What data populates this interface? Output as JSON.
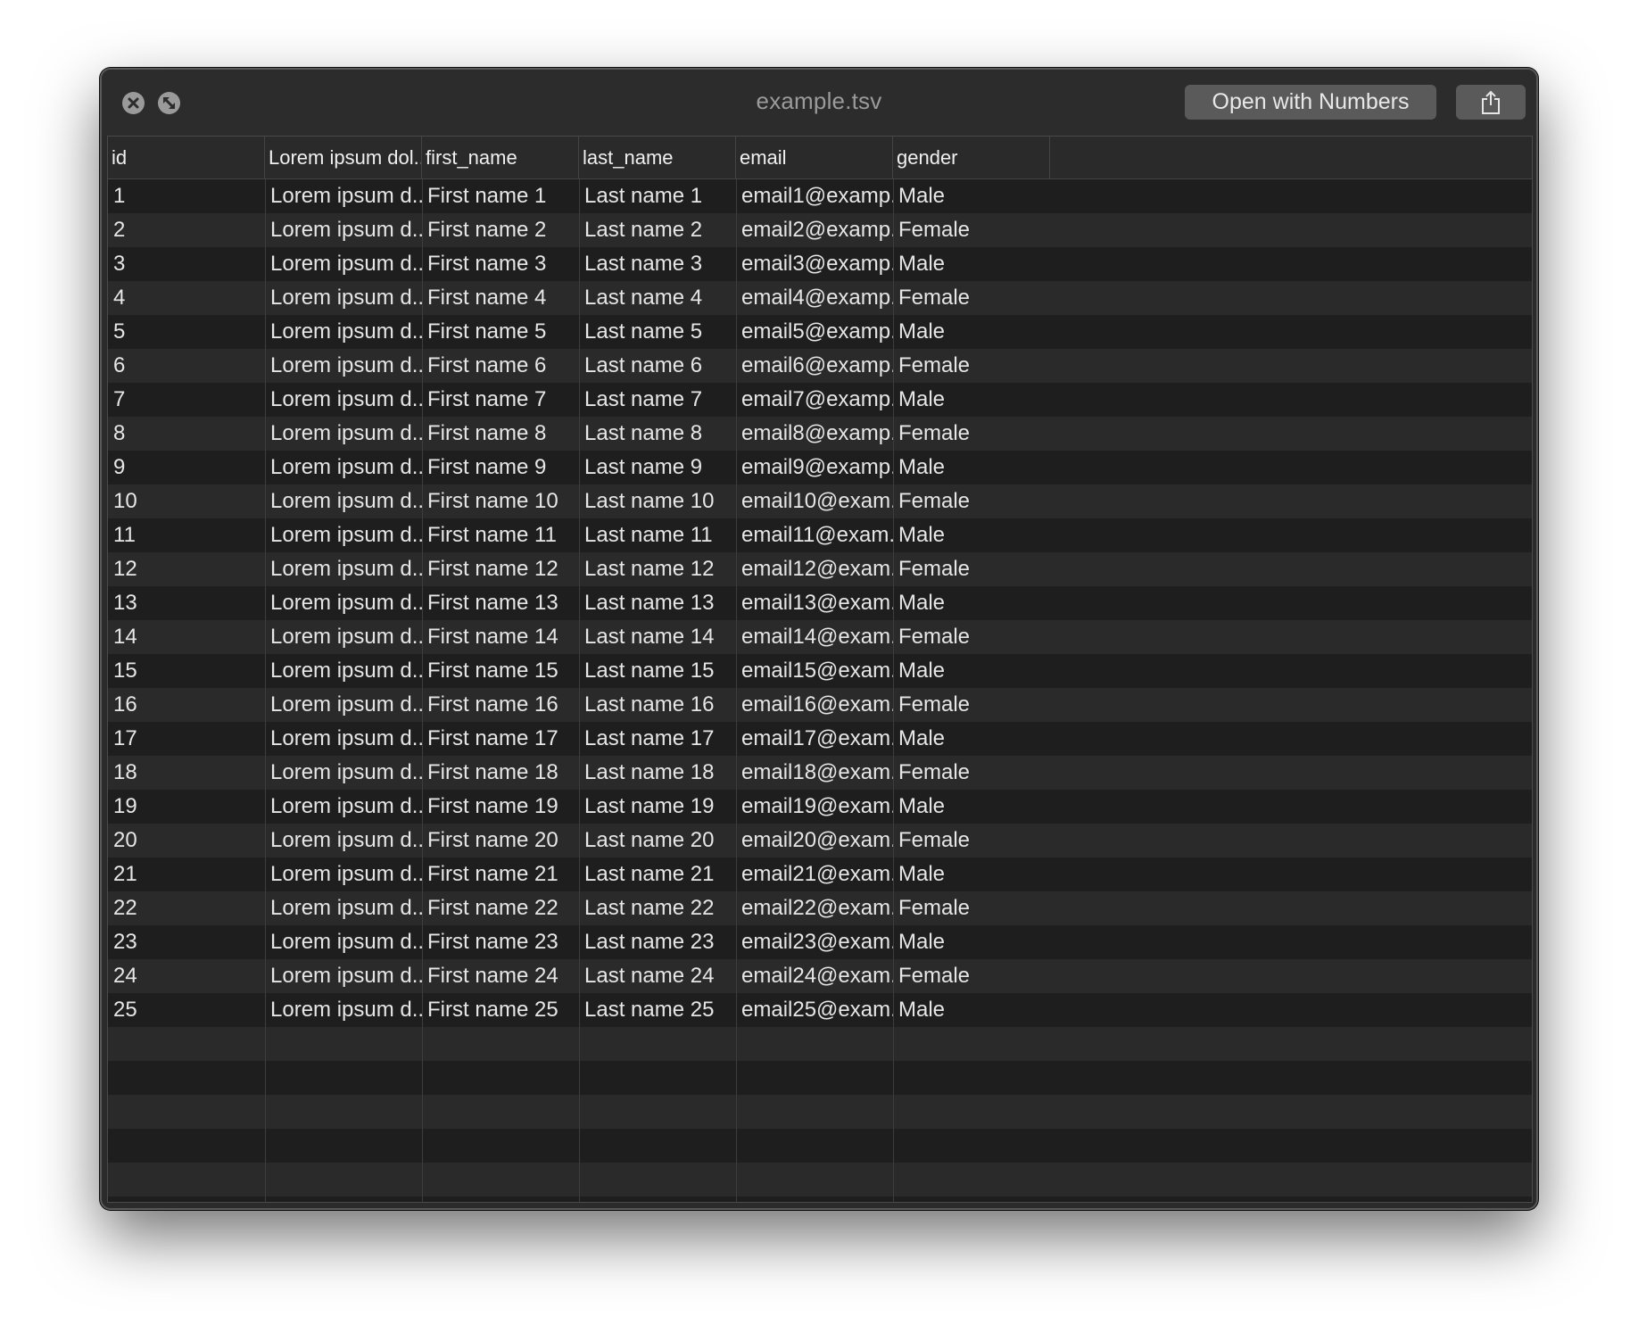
{
  "window": {
    "title": "example.tsv",
    "open_button_label": "Open with Numbers",
    "icons": {
      "close": "close-icon",
      "fullscreen": "fullscreen-icon",
      "share": "share-icon"
    }
  },
  "table": {
    "columns": [
      "id",
      "Lorem ipsum dol...",
      "first_name",
      "last_name",
      "email",
      "gender"
    ],
    "rows": [
      [
        "1",
        "Lorem ipsum d...",
        "First name 1",
        "Last name 1",
        "email1@examp...",
        "Male"
      ],
      [
        "2",
        "Lorem ipsum d...",
        "First name 2",
        "Last name 2",
        "email2@examp...",
        "Female"
      ],
      [
        "3",
        "Lorem ipsum d...",
        "First name 3",
        "Last name 3",
        "email3@examp...",
        "Male"
      ],
      [
        "4",
        "Lorem ipsum d...",
        "First name 4",
        "Last name 4",
        "email4@examp...",
        "Female"
      ],
      [
        "5",
        "Lorem ipsum d...",
        "First name 5",
        "Last name 5",
        "email5@examp...",
        "Male"
      ],
      [
        "6",
        "Lorem ipsum d...",
        "First name 6",
        "Last name 6",
        "email6@examp...",
        "Female"
      ],
      [
        "7",
        "Lorem ipsum d...",
        "First name 7",
        "Last name 7",
        "email7@examp...",
        "Male"
      ],
      [
        "8",
        "Lorem ipsum d...",
        "First name 8",
        "Last name 8",
        "email8@examp...",
        "Female"
      ],
      [
        "9",
        "Lorem ipsum d...",
        "First name 9",
        "Last name 9",
        "email9@examp...",
        "Male"
      ],
      [
        "10",
        "Lorem ipsum d...",
        "First name 10",
        "Last name 10",
        "email10@exam...",
        "Female"
      ],
      [
        "11",
        "Lorem ipsum d...",
        "First name 11",
        "Last name 11",
        "email11@exam...",
        "Male"
      ],
      [
        "12",
        "Lorem ipsum d...",
        "First name 12",
        "Last name 12",
        "email12@exam...",
        "Female"
      ],
      [
        "13",
        "Lorem ipsum d...",
        "First name 13",
        "Last name 13",
        "email13@exam...",
        "Male"
      ],
      [
        "14",
        "Lorem ipsum d...",
        "First name 14",
        "Last name 14",
        "email14@exam...",
        "Female"
      ],
      [
        "15",
        "Lorem ipsum d...",
        "First name 15",
        "Last name 15",
        "email15@exam...",
        "Male"
      ],
      [
        "16",
        "Lorem ipsum d...",
        "First name 16",
        "Last name 16",
        "email16@exam...",
        "Female"
      ],
      [
        "17",
        "Lorem ipsum d...",
        "First name 17",
        "Last name 17",
        "email17@exam...",
        "Male"
      ],
      [
        "18",
        "Lorem ipsum d...",
        "First name 18",
        "Last name 18",
        "email18@exam...",
        "Female"
      ],
      [
        "19",
        "Lorem ipsum d...",
        "First name 19",
        "Last name 19",
        "email19@exam...",
        "Male"
      ],
      [
        "20",
        "Lorem ipsum d...",
        "First name 20",
        "Last name 20",
        "email20@exam...",
        "Female"
      ],
      [
        "21",
        "Lorem ipsum d...",
        "First name 21",
        "Last name 21",
        "email21@exam...",
        "Male"
      ],
      [
        "22",
        "Lorem ipsum d...",
        "First name 22",
        "Last name 22",
        "email22@exam...",
        "Female"
      ],
      [
        "23",
        "Lorem ipsum d...",
        "First name 23",
        "Last name 23",
        "email23@exam...",
        "Male"
      ],
      [
        "24",
        "Lorem ipsum d...",
        "First name 24",
        "Last name 24",
        "email24@exam...",
        "Female"
      ],
      [
        "25",
        "Lorem ipsum d...",
        "First name 25",
        "Last name 25",
        "email25@exam...",
        "Male"
      ]
    ]
  }
}
